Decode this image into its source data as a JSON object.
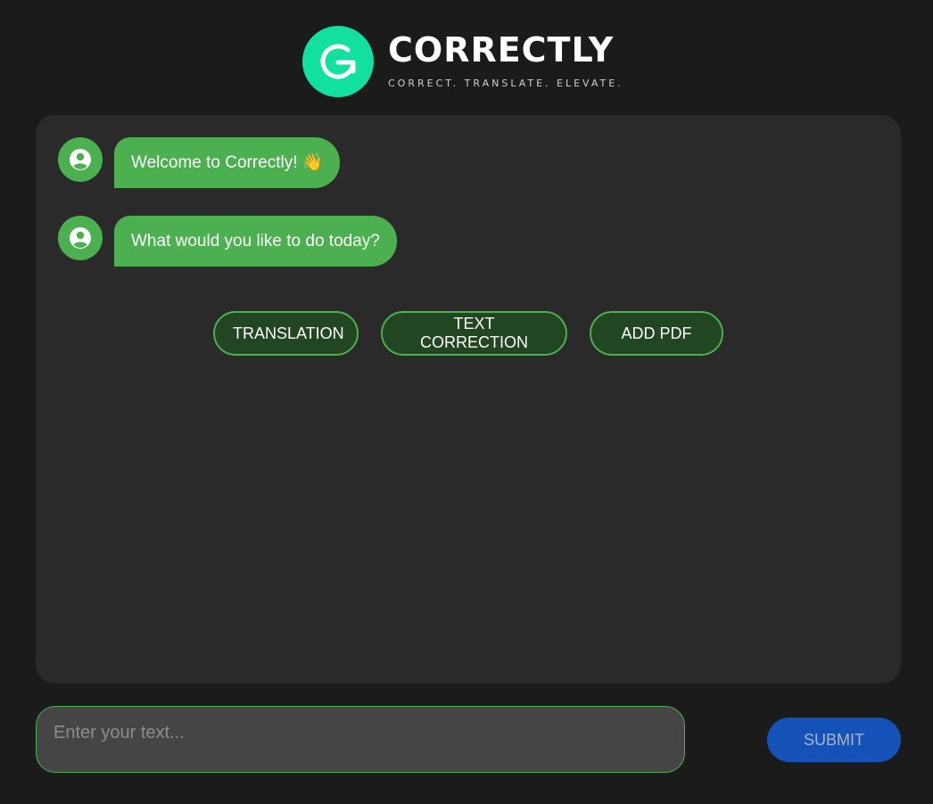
{
  "header": {
    "brand_name": "CORRECTLY",
    "tagline": "CORRECT. TRANSLATE. ELEVATE.",
    "logo_icon": "g-arrow-logo-icon",
    "logo_color": "#12e0a1"
  },
  "chat": {
    "messages": [
      {
        "text": "Welcome to Correctly! 👋",
        "avatar_icon": "user-circle-icon"
      },
      {
        "text": "What would you like to do today?",
        "avatar_icon": "user-circle-icon"
      }
    ],
    "options": [
      {
        "label": "TRANSLATION"
      },
      {
        "label": "TEXT CORRECTION"
      },
      {
        "label": "ADD PDF"
      }
    ]
  },
  "composer": {
    "placeholder": "Enter your text...",
    "value": "",
    "submit_label": "SUBMIT"
  },
  "colors": {
    "background": "#1b1b1b",
    "panel": "#2a2a2a",
    "accent_green": "#4caf50",
    "option_fill": "#214621",
    "submit_blue": "#1552b8",
    "input_fill": "#454545"
  }
}
